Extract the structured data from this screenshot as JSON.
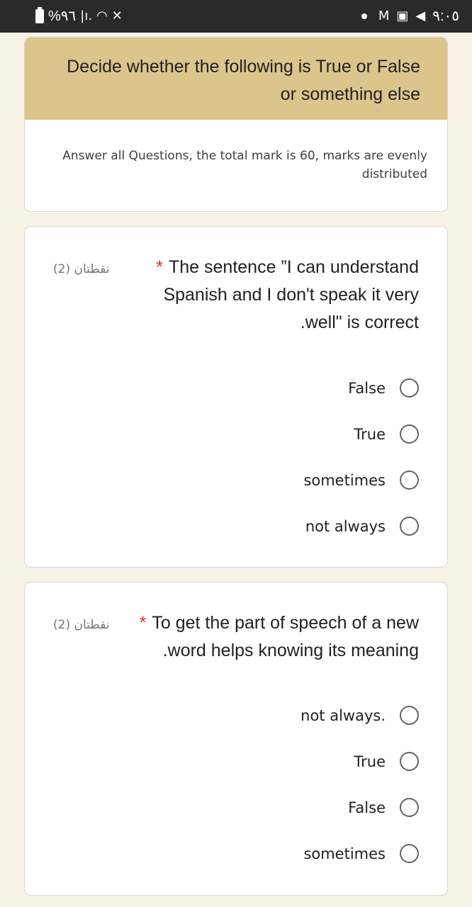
{
  "status_bar": {
    "battery": "%٩٦",
    "signal": "|ı.",
    "wifi": "◠",
    "mute": "✕",
    "gmail": "M",
    "gallery": "▣",
    "telegram": "◀",
    "time": "٩:٠٥"
  },
  "form": {
    "title": "Decide whether the following is True or False or something else",
    "description": "Answer all Questions, the total mark is 60, marks are evenly distributed"
  },
  "questions": [
    {
      "points": "نقطتان (2)",
      "text": "The sentence ”I can understand Spanish and I don't speak it very .well\" is correct",
      "required_mark": "*",
      "options": [
        "False",
        "True",
        "sometimes",
        "not always"
      ]
    },
    {
      "points": "نقطتان (2)",
      "text": "To get the part of speech of a new .word helps knowing its meaning",
      "required_mark": "*",
      "options": [
        "not always.",
        "True",
        "False",
        "sometimes"
      ]
    }
  ]
}
